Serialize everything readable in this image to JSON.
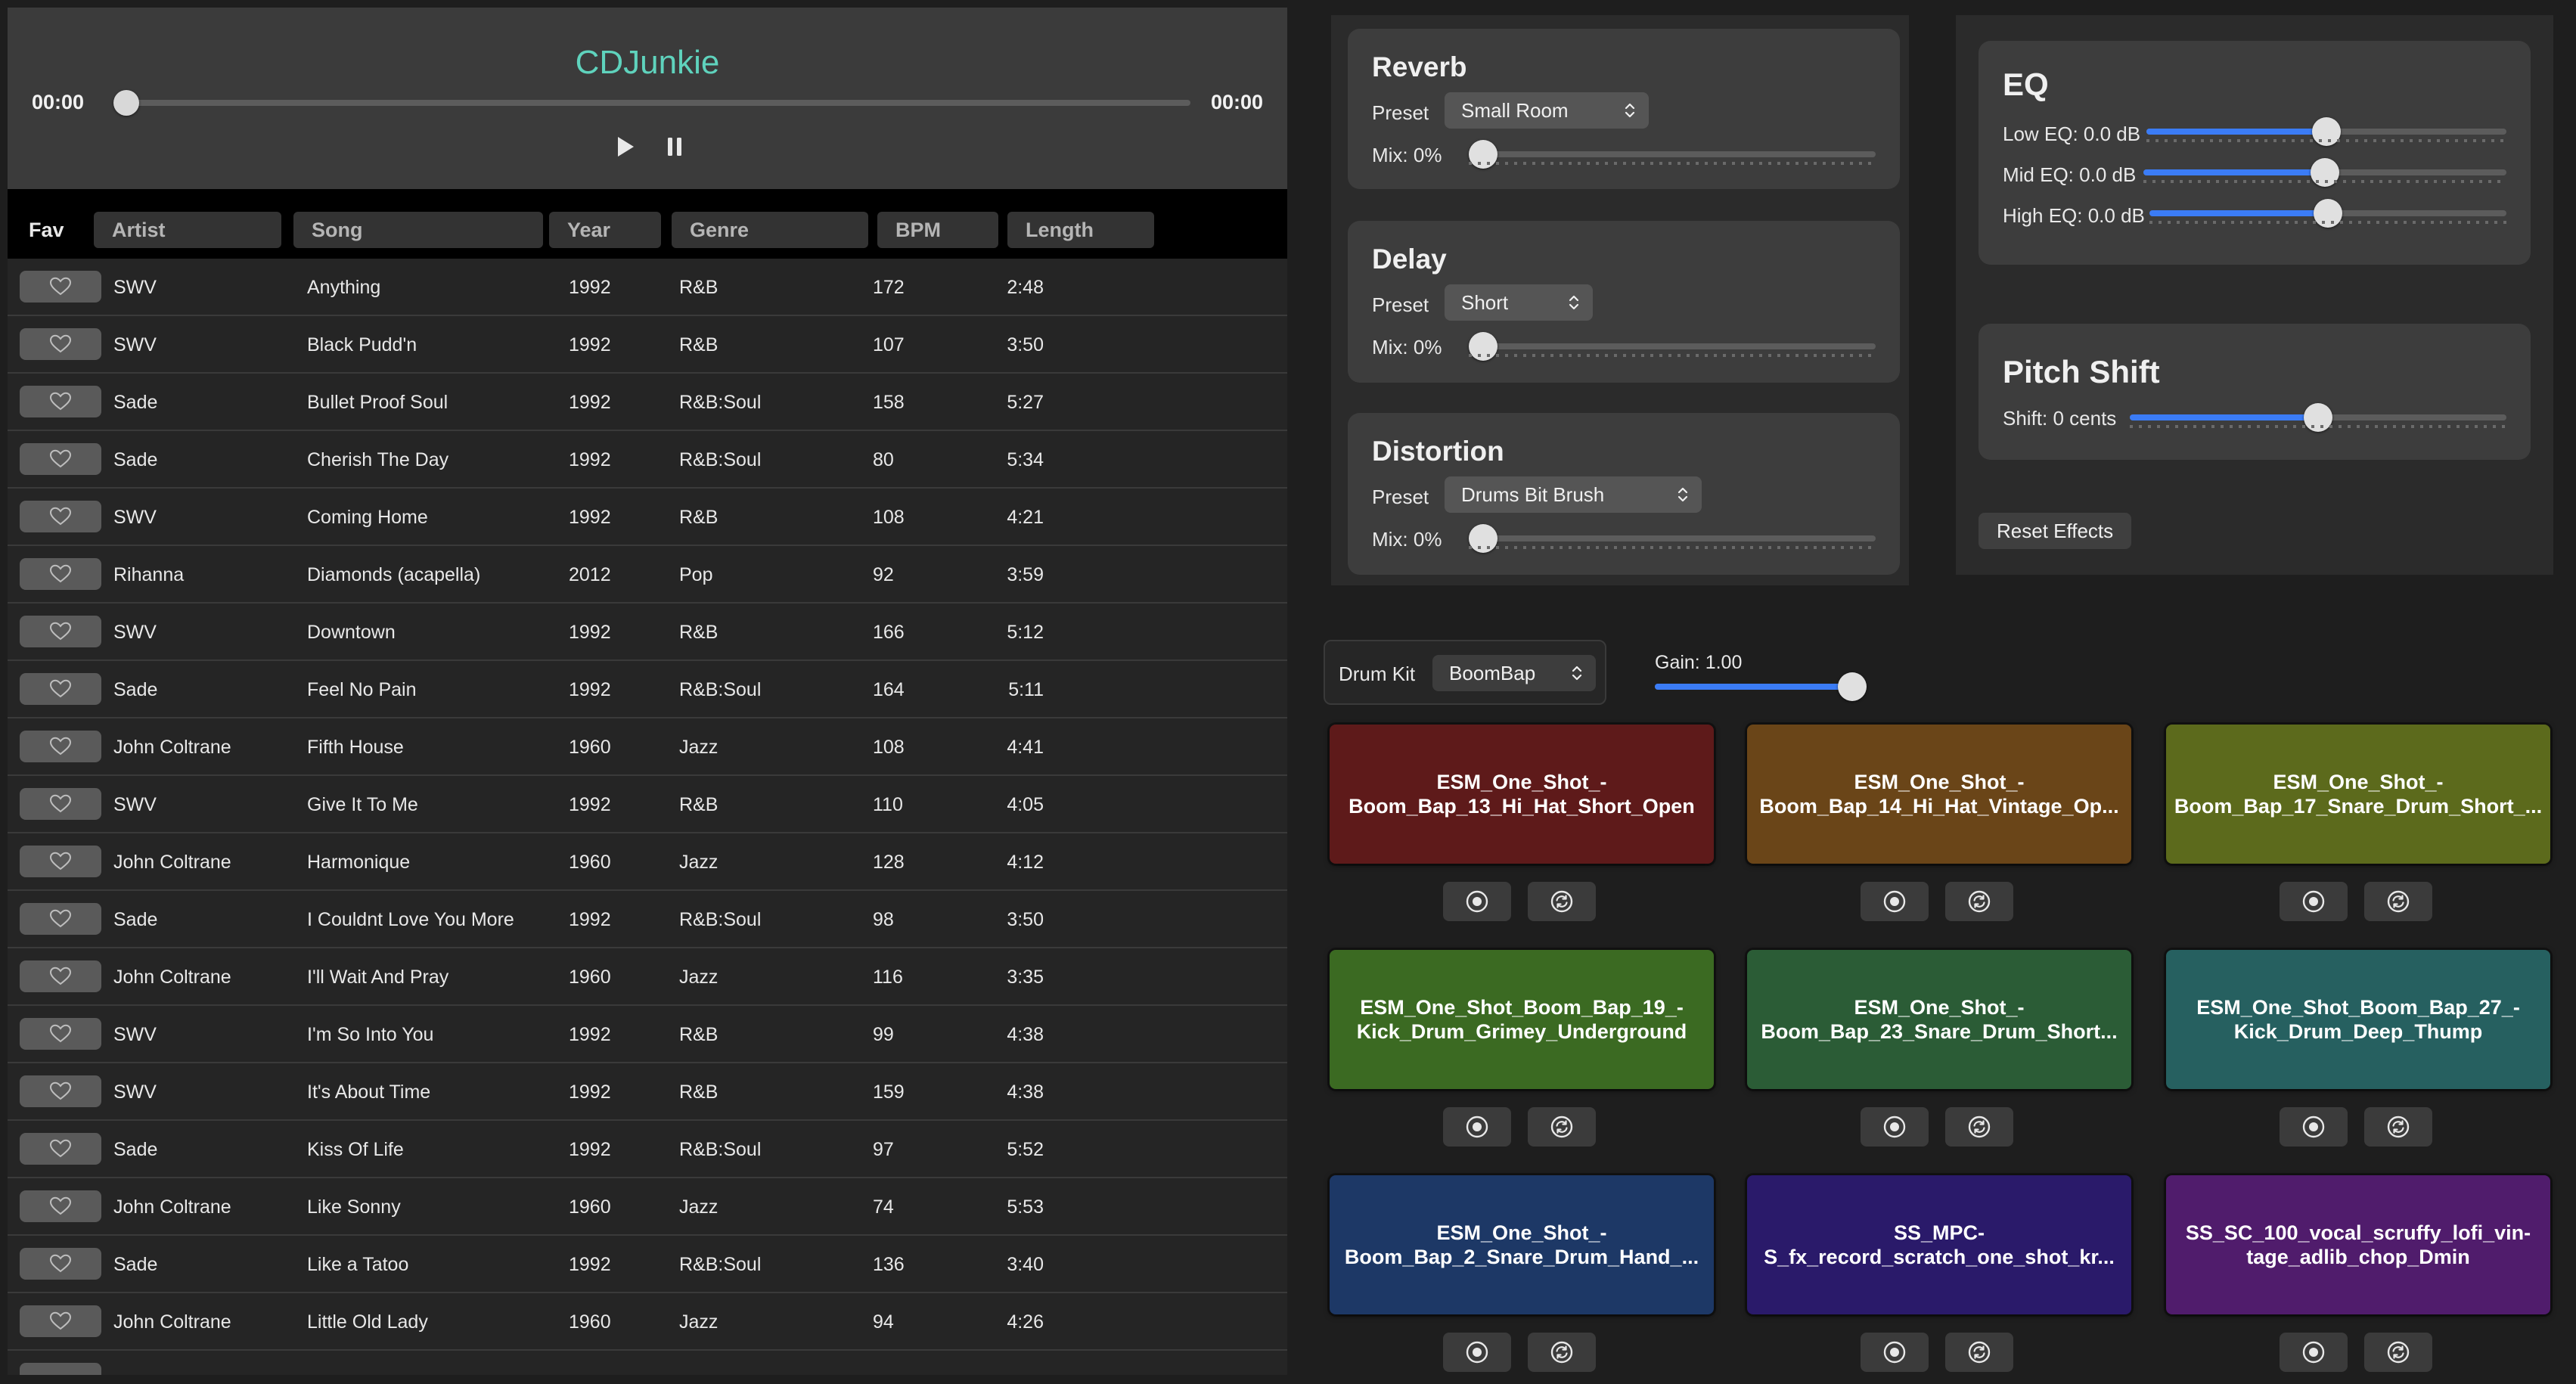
{
  "player": {
    "title": "CDJunkie",
    "current_time": "00:00",
    "total_time": "00:00",
    "progress": 0
  },
  "table": {
    "headers": {
      "fav": "Fav",
      "artist": "Artist",
      "song": "Song",
      "year": "Year",
      "genre": "Genre",
      "bpm": "BPM",
      "length": "Length"
    },
    "rows": [
      {
        "artist": "SWV",
        "song": "Anything",
        "year": "1992",
        "genre": "R&B",
        "bpm": "172",
        "length": "2:48"
      },
      {
        "artist": "SWV",
        "song": "Black Pudd'n",
        "year": "1992",
        "genre": "R&B",
        "bpm": "107",
        "length": "3:50"
      },
      {
        "artist": "Sade",
        "song": "Bullet Proof Soul",
        "year": "1992",
        "genre": "R&B:Soul",
        "bpm": "158",
        "length": "5:27"
      },
      {
        "artist": "Sade",
        "song": "Cherish The Day",
        "year": "1992",
        "genre": "R&B:Soul",
        "bpm": "80",
        "length": "5:34"
      },
      {
        "artist": "SWV",
        "song": "Coming Home",
        "year": "1992",
        "genre": "R&B",
        "bpm": "108",
        "length": "4:21"
      },
      {
        "artist": "Rihanna",
        "song": "Diamonds (acapella)",
        "year": "2012",
        "genre": "Pop",
        "bpm": "92",
        "length": "3:59"
      },
      {
        "artist": "SWV",
        "song": "Downtown",
        "year": "1992",
        "genre": "R&B",
        "bpm": "166",
        "length": "5:12"
      },
      {
        "artist": "Sade",
        "song": "Feel No Pain",
        "year": "1992",
        "genre": "R&B:Soul",
        "bpm": "164",
        "length": "5:11"
      },
      {
        "artist": "John Coltrane",
        "song": "Fifth House",
        "year": "1960",
        "genre": "Jazz",
        "bpm": "108",
        "length": "4:41"
      },
      {
        "artist": "SWV",
        "song": "Give It To Me",
        "year": "1992",
        "genre": "R&B",
        "bpm": "110",
        "length": "4:05"
      },
      {
        "artist": "John Coltrane",
        "song": "Harmonique",
        "year": "1960",
        "genre": "Jazz",
        "bpm": "128",
        "length": "4:12"
      },
      {
        "artist": "Sade",
        "song": "I Couldnt Love You More",
        "year": "1992",
        "genre": "R&B:Soul",
        "bpm": "98",
        "length": "3:50"
      },
      {
        "artist": "John Coltrane",
        "song": "I'll Wait And Pray",
        "year": "1960",
        "genre": "Jazz",
        "bpm": "116",
        "length": "3:35"
      },
      {
        "artist": "SWV",
        "song": "I'm So Into You",
        "year": "1992",
        "genre": "R&B",
        "bpm": "99",
        "length": "4:38"
      },
      {
        "artist": "SWV",
        "song": "It's About Time",
        "year": "1992",
        "genre": "R&B",
        "bpm": "159",
        "length": "4:38"
      },
      {
        "artist": "Sade",
        "song": "Kiss Of Life",
        "year": "1992",
        "genre": "R&B:Soul",
        "bpm": "97",
        "length": "5:52"
      },
      {
        "artist": "John Coltrane",
        "song": "Like Sonny",
        "year": "1960",
        "genre": "Jazz",
        "bpm": "74",
        "length": "5:53"
      },
      {
        "artist": "Sade",
        "song": "Like a Tatoo",
        "year": "1992",
        "genre": "R&B:Soul",
        "bpm": "136",
        "length": "3:40"
      },
      {
        "artist": "John Coltrane",
        "song": "Little Old Lady",
        "year": "1960",
        "genre": "Jazz",
        "bpm": "94",
        "length": "4:26"
      }
    ]
  },
  "effects": {
    "reverb": {
      "title": "Reverb",
      "preset_label": "Preset",
      "preset": "Small Room",
      "mix_label": "Mix: 0%",
      "mix": 0
    },
    "delay": {
      "title": "Delay",
      "preset_label": "Preset",
      "preset": "Short",
      "mix_label": "Mix: 0%",
      "mix": 0
    },
    "distortion": {
      "title": "Distortion",
      "preset_label": "Preset",
      "preset": "Drums Bit Brush",
      "mix_label": "Mix: 0%",
      "mix": 0
    },
    "eq": {
      "title": "EQ",
      "low_label": "Low EQ: 0.0 dB",
      "low": 0.5,
      "mid_label": "Mid EQ: 0.0 dB",
      "mid": 0.5,
      "high_label": "High EQ: 0.0 dB",
      "high": 0.5
    },
    "pitch": {
      "title": "Pitch Shift",
      "shift_label": "Shift: 0 cents",
      "shift": 0.5
    },
    "reset_label": "Reset Effects"
  },
  "drums": {
    "kit_label": "Drum Kit",
    "kit": "BoomBap",
    "gain_label": "Gain: 1.00",
    "gain": 1.0,
    "pads": [
      {
        "name": "ESM_One_Shot_-\nBoom_Bap_13_Hi_Hat_Short_Open",
        "color": "#5e1a1a"
      },
      {
        "name": "ESM_One_Shot_-\nBoom_Bap_14_Hi_Hat_Vintage_Op...",
        "color": "#6a4518"
      },
      {
        "name": "ESM_One_Shot_-\nBoom_Bap_17_Snare_Drum_Short_...",
        "color": "#5c6a1c"
      },
      {
        "name": "ESM_One_Shot_Boom_Bap_19_-\nKick_Drum_Grimey_Underground",
        "color": "#3b6a22"
      },
      {
        "name": "ESM_One_Shot_-\nBoom_Bap_23_Snare_Drum_Short...",
        "color": "#2b5c36"
      },
      {
        "name": "ESM_One_Shot_Boom_Bap_27_-\nKick_Drum_Deep_Thump",
        "color": "#266060"
      },
      {
        "name": "ESM_One_Shot_-\nBoom_Bap_2_Snare_Drum_Hand_...",
        "color": "#1d3866"
      },
      {
        "name": "SS_MPC-\nS_fx_record_scratch_one_shot_kr...",
        "color": "#2a1a6a"
      },
      {
        "name": "SS_SC_100_vocal_scruffy_lofi_vin-\ntage_adlib_chop_Dmin",
        "color": "#501c6c"
      }
    ]
  },
  "icons": {
    "play": "play-icon",
    "pause": "pause-icon",
    "heart": "heart-icon",
    "record": "record-icon",
    "loop": "loop-icon",
    "chevron": "chevron-updown-icon"
  }
}
